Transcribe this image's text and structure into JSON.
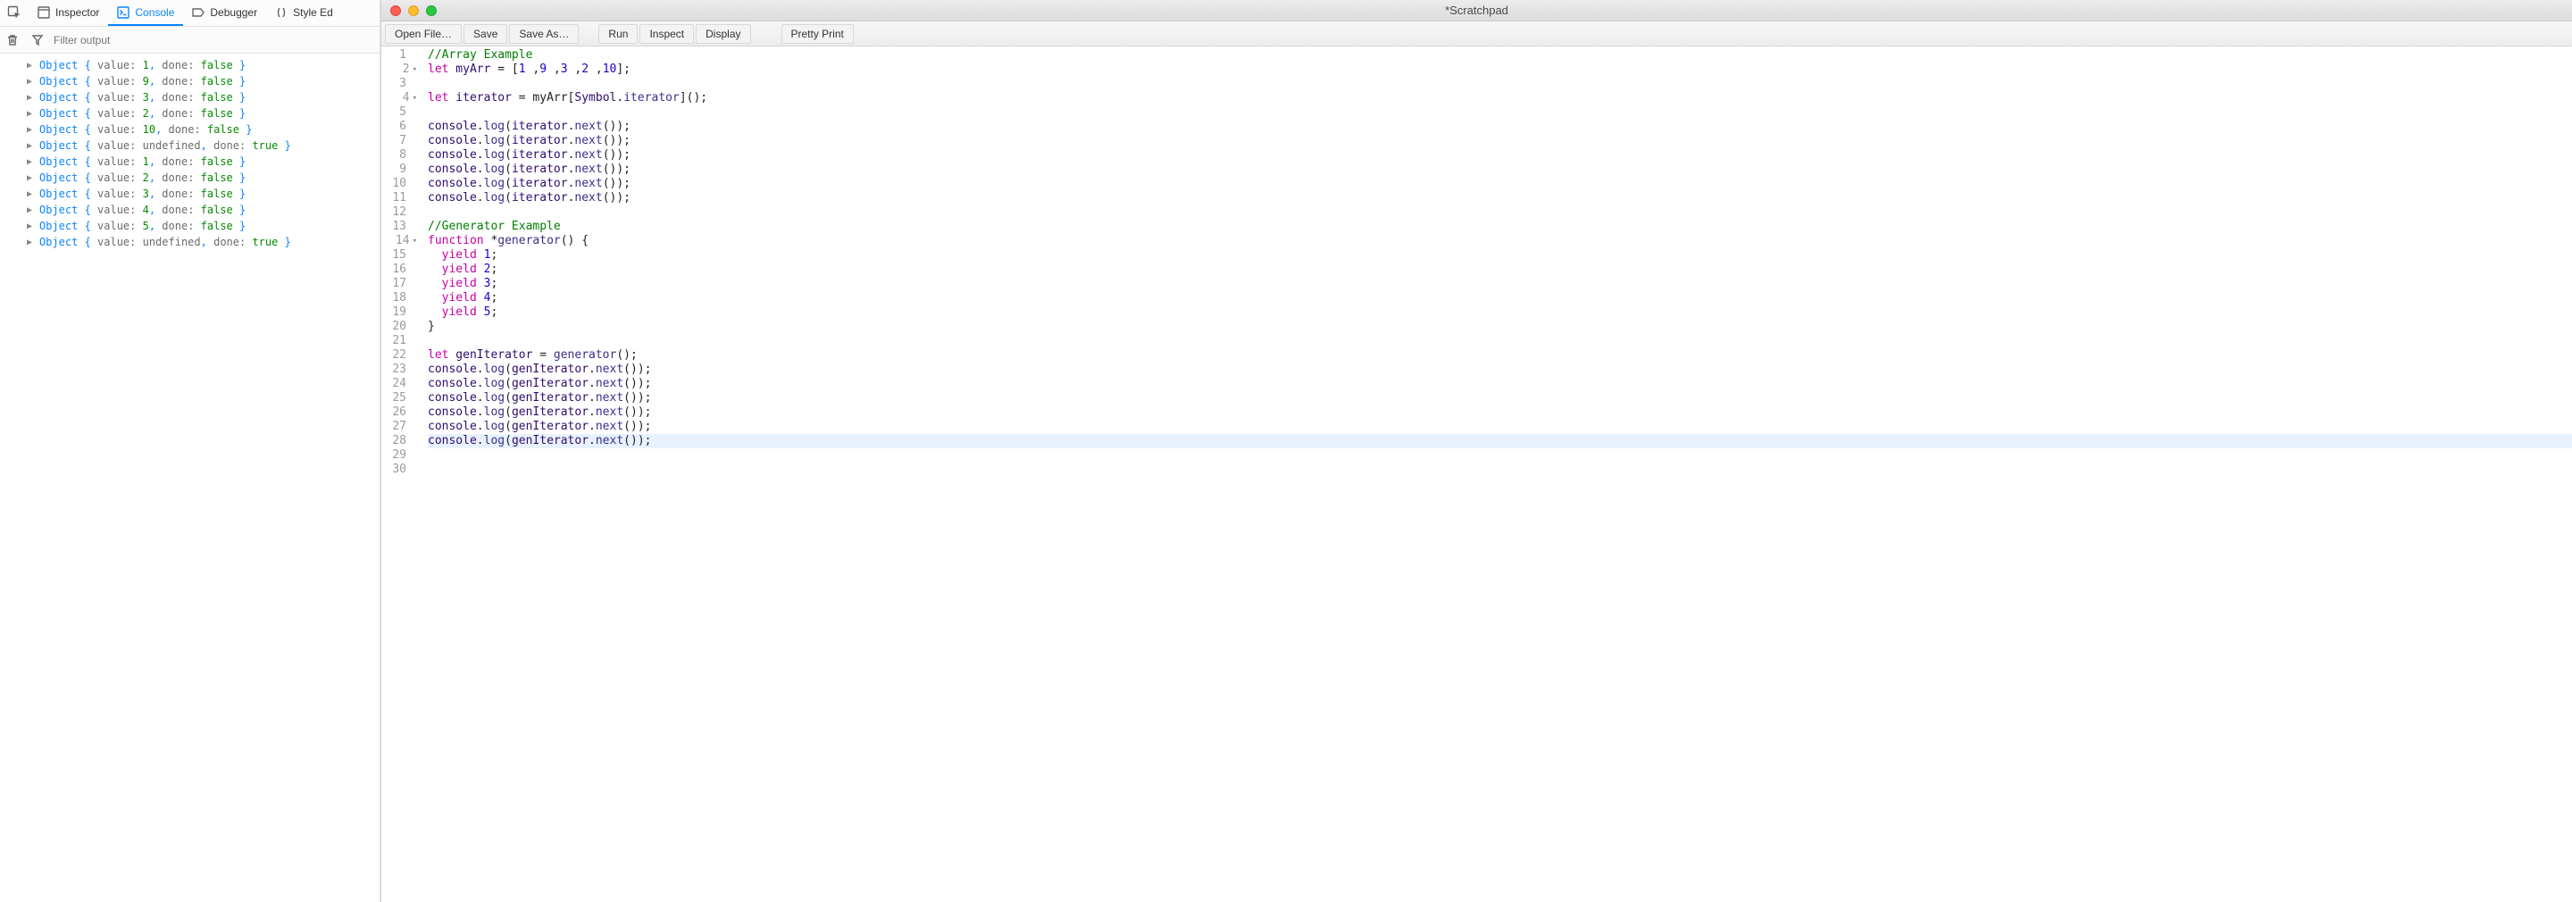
{
  "devtools": {
    "tabs": {
      "inspector": "Inspector",
      "console": "Console",
      "debugger": "Debugger",
      "style": "Style Ed"
    },
    "filter_placeholder": "Filter output",
    "console_rows": [
      {
        "value": "1",
        "value_kind": "num",
        "done": "false",
        "done_kind": "bool"
      },
      {
        "value": "9",
        "value_kind": "num",
        "done": "false",
        "done_kind": "bool"
      },
      {
        "value": "3",
        "value_kind": "num",
        "done": "false",
        "done_kind": "bool"
      },
      {
        "value": "2",
        "value_kind": "num",
        "done": "false",
        "done_kind": "bool"
      },
      {
        "value": "10",
        "value_kind": "num",
        "done": "false",
        "done_kind": "bool"
      },
      {
        "value": "undefined",
        "value_kind": "undef",
        "done": "true",
        "done_kind": "bool"
      },
      {
        "value": "1",
        "value_kind": "num",
        "done": "false",
        "done_kind": "bool"
      },
      {
        "value": "2",
        "value_kind": "num",
        "done": "false",
        "done_kind": "bool"
      },
      {
        "value": "3",
        "value_kind": "num",
        "done": "false",
        "done_kind": "bool"
      },
      {
        "value": "4",
        "value_kind": "num",
        "done": "false",
        "done_kind": "bool"
      },
      {
        "value": "5",
        "value_kind": "num",
        "done": "false",
        "done_kind": "bool"
      },
      {
        "value": "undefined",
        "value_kind": "undef",
        "done": "true",
        "done_kind": "bool"
      }
    ],
    "obj_label": "Object",
    "key_value": "value:",
    "key_done": "done:"
  },
  "scratchpad": {
    "title": "*Scratchpad",
    "buttons": {
      "open": "Open File…",
      "save": "Save",
      "saveas": "Save As…",
      "run": "Run",
      "inspect": "Inspect",
      "display": "Display",
      "pretty": "Pretty Print"
    },
    "line_count": 30,
    "fold_lines": [
      2,
      4,
      14
    ],
    "highlight_line": 28,
    "code": [
      [
        {
          "t": "//Array Example",
          "c": "cm"
        }
      ],
      [
        {
          "t": "let",
          "c": "kw"
        },
        {
          "t": " myArr ",
          "c": "id"
        },
        {
          "t": "=",
          "c": "op"
        },
        {
          "t": " [",
          "c": "punc2"
        },
        {
          "t": "1",
          "c": "num2"
        },
        {
          "t": " ,",
          "c": "punc2"
        },
        {
          "t": "9",
          "c": "num2"
        },
        {
          "t": " ,",
          "c": "punc2"
        },
        {
          "t": "3",
          "c": "num2"
        },
        {
          "t": " ,",
          "c": "punc2"
        },
        {
          "t": "2",
          "c": "num2"
        },
        {
          "t": " ,",
          "c": "punc2"
        },
        {
          "t": "10",
          "c": "num2"
        },
        {
          "t": "];",
          "c": "punc2"
        }
      ],
      [],
      [
        {
          "t": "let",
          "c": "kw"
        },
        {
          "t": " iterator ",
          "c": "id"
        },
        {
          "t": "=",
          "c": "op"
        },
        {
          "t": " myArr[",
          "c": "punc2"
        },
        {
          "t": "Symbol",
          "c": "id"
        },
        {
          "t": ".",
          "c": "punc2"
        },
        {
          "t": "iterator",
          "c": "fn"
        },
        {
          "t": "]();",
          "c": "punc2"
        }
      ],
      [],
      [
        {
          "t": "console",
          "c": "id"
        },
        {
          "t": ".",
          "c": "punc2"
        },
        {
          "t": "log",
          "c": "fn"
        },
        {
          "t": "(",
          "c": "punc2"
        },
        {
          "t": "iterator",
          "c": "id"
        },
        {
          "t": ".",
          "c": "punc2"
        },
        {
          "t": "next",
          "c": "fn"
        },
        {
          "t": "());",
          "c": "punc2"
        }
      ],
      [
        {
          "t": "console",
          "c": "id"
        },
        {
          "t": ".",
          "c": "punc2"
        },
        {
          "t": "log",
          "c": "fn"
        },
        {
          "t": "(",
          "c": "punc2"
        },
        {
          "t": "iterator",
          "c": "id"
        },
        {
          "t": ".",
          "c": "punc2"
        },
        {
          "t": "next",
          "c": "fn"
        },
        {
          "t": "());",
          "c": "punc2"
        }
      ],
      [
        {
          "t": "console",
          "c": "id"
        },
        {
          "t": ".",
          "c": "punc2"
        },
        {
          "t": "log",
          "c": "fn"
        },
        {
          "t": "(",
          "c": "punc2"
        },
        {
          "t": "iterator",
          "c": "id"
        },
        {
          "t": ".",
          "c": "punc2"
        },
        {
          "t": "next",
          "c": "fn"
        },
        {
          "t": "());",
          "c": "punc2"
        }
      ],
      [
        {
          "t": "console",
          "c": "id"
        },
        {
          "t": ".",
          "c": "punc2"
        },
        {
          "t": "log",
          "c": "fn"
        },
        {
          "t": "(",
          "c": "punc2"
        },
        {
          "t": "iterator",
          "c": "id"
        },
        {
          "t": ".",
          "c": "punc2"
        },
        {
          "t": "next",
          "c": "fn"
        },
        {
          "t": "());",
          "c": "punc2"
        }
      ],
      [
        {
          "t": "console",
          "c": "id"
        },
        {
          "t": ".",
          "c": "punc2"
        },
        {
          "t": "log",
          "c": "fn"
        },
        {
          "t": "(",
          "c": "punc2"
        },
        {
          "t": "iterator",
          "c": "id"
        },
        {
          "t": ".",
          "c": "punc2"
        },
        {
          "t": "next",
          "c": "fn"
        },
        {
          "t": "());",
          "c": "punc2"
        }
      ],
      [
        {
          "t": "console",
          "c": "id"
        },
        {
          "t": ".",
          "c": "punc2"
        },
        {
          "t": "log",
          "c": "fn"
        },
        {
          "t": "(",
          "c": "punc2"
        },
        {
          "t": "iterator",
          "c": "id"
        },
        {
          "t": ".",
          "c": "punc2"
        },
        {
          "t": "next",
          "c": "fn"
        },
        {
          "t": "());",
          "c": "punc2"
        }
      ],
      [],
      [
        {
          "t": "//Generator Example",
          "c": "cm"
        }
      ],
      [
        {
          "t": "function",
          "c": "kw"
        },
        {
          "t": " *",
          "c": "op"
        },
        {
          "t": "generator",
          "c": "fn"
        },
        {
          "t": "() {",
          "c": "punc2"
        }
      ],
      [
        {
          "t": "  ",
          "c": "punc2"
        },
        {
          "t": "yield",
          "c": "kw"
        },
        {
          "t": " ",
          "c": "punc2"
        },
        {
          "t": "1",
          "c": "num2"
        },
        {
          "t": ";",
          "c": "punc2"
        }
      ],
      [
        {
          "t": "  ",
          "c": "punc2"
        },
        {
          "t": "yield",
          "c": "kw"
        },
        {
          "t": " ",
          "c": "punc2"
        },
        {
          "t": "2",
          "c": "num2"
        },
        {
          "t": ";",
          "c": "punc2"
        }
      ],
      [
        {
          "t": "  ",
          "c": "punc2"
        },
        {
          "t": "yield",
          "c": "kw"
        },
        {
          "t": " ",
          "c": "punc2"
        },
        {
          "t": "3",
          "c": "num2"
        },
        {
          "t": ";",
          "c": "punc2"
        }
      ],
      [
        {
          "t": "  ",
          "c": "punc2"
        },
        {
          "t": "yield",
          "c": "kw"
        },
        {
          "t": " ",
          "c": "punc2"
        },
        {
          "t": "4",
          "c": "num2"
        },
        {
          "t": ";",
          "c": "punc2"
        }
      ],
      [
        {
          "t": "  ",
          "c": "punc2"
        },
        {
          "t": "yield",
          "c": "kw"
        },
        {
          "t": " ",
          "c": "punc2"
        },
        {
          "t": "5",
          "c": "num2"
        },
        {
          "t": ";",
          "c": "punc2"
        }
      ],
      [
        {
          "t": "}",
          "c": "punc2"
        }
      ],
      [],
      [
        {
          "t": "let",
          "c": "kw"
        },
        {
          "t": " genIterator ",
          "c": "id"
        },
        {
          "t": "=",
          "c": "op"
        },
        {
          "t": " ",
          "c": "punc2"
        },
        {
          "t": "generator",
          "c": "fn"
        },
        {
          "t": "();",
          "c": "punc2"
        }
      ],
      [
        {
          "t": "console",
          "c": "id"
        },
        {
          "t": ".",
          "c": "punc2"
        },
        {
          "t": "log",
          "c": "fn"
        },
        {
          "t": "(",
          "c": "punc2"
        },
        {
          "t": "genIterator",
          "c": "id"
        },
        {
          "t": ".",
          "c": "punc2"
        },
        {
          "t": "next",
          "c": "fn"
        },
        {
          "t": "());",
          "c": "punc2"
        }
      ],
      [
        {
          "t": "console",
          "c": "id"
        },
        {
          "t": ".",
          "c": "punc2"
        },
        {
          "t": "log",
          "c": "fn"
        },
        {
          "t": "(",
          "c": "punc2"
        },
        {
          "t": "genIterator",
          "c": "id"
        },
        {
          "t": ".",
          "c": "punc2"
        },
        {
          "t": "next",
          "c": "fn"
        },
        {
          "t": "());",
          "c": "punc2"
        }
      ],
      [
        {
          "t": "console",
          "c": "id"
        },
        {
          "t": ".",
          "c": "punc2"
        },
        {
          "t": "log",
          "c": "fn"
        },
        {
          "t": "(",
          "c": "punc2"
        },
        {
          "t": "genIterator",
          "c": "id"
        },
        {
          "t": ".",
          "c": "punc2"
        },
        {
          "t": "next",
          "c": "fn"
        },
        {
          "t": "());",
          "c": "punc2"
        }
      ],
      [
        {
          "t": "console",
          "c": "id"
        },
        {
          "t": ".",
          "c": "punc2"
        },
        {
          "t": "log",
          "c": "fn"
        },
        {
          "t": "(",
          "c": "punc2"
        },
        {
          "t": "genIterator",
          "c": "id"
        },
        {
          "t": ".",
          "c": "punc2"
        },
        {
          "t": "next",
          "c": "fn"
        },
        {
          "t": "());",
          "c": "punc2"
        }
      ],
      [
        {
          "t": "console",
          "c": "id"
        },
        {
          "t": ".",
          "c": "punc2"
        },
        {
          "t": "log",
          "c": "fn"
        },
        {
          "t": "(",
          "c": "punc2"
        },
        {
          "t": "genIterator",
          "c": "id"
        },
        {
          "t": ".",
          "c": "punc2"
        },
        {
          "t": "next",
          "c": "fn"
        },
        {
          "t": "());",
          "c": "punc2"
        }
      ],
      [
        {
          "t": "console",
          "c": "id"
        },
        {
          "t": ".",
          "c": "punc2"
        },
        {
          "t": "log",
          "c": "fn"
        },
        {
          "t": "(",
          "c": "punc2"
        },
        {
          "t": "genIterator",
          "c": "id"
        },
        {
          "t": ".",
          "c": "punc2"
        },
        {
          "t": "next",
          "c": "fn"
        },
        {
          "t": "());",
          "c": "punc2"
        }
      ],
      [],
      []
    ]
  }
}
